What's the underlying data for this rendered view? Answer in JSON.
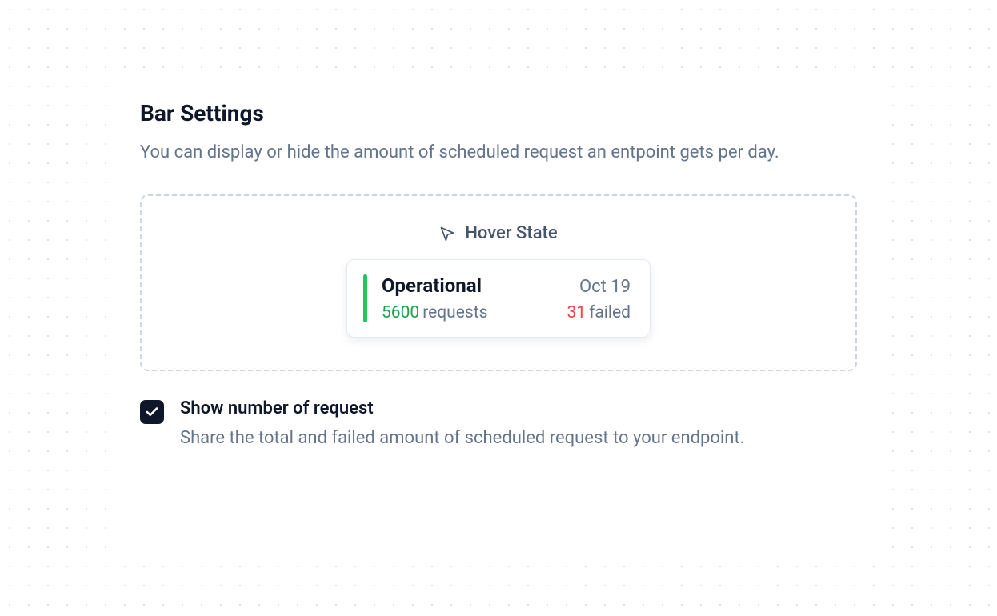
{
  "header": {
    "title": "Bar Settings",
    "description": "You can display or hide the amount of scheduled request an entpoint gets per day."
  },
  "preview": {
    "hoverLabel": "Hover State",
    "card": {
      "status": "Operational",
      "date": "Oct 19",
      "requestsCount": "5600",
      "requestsLabel": "requests",
      "failedCount": "31",
      "failedLabel": "failed"
    }
  },
  "option": {
    "title": "Show number of request",
    "description": "Share the total and failed amount of scheduled request to your endpoint.",
    "checked": true
  },
  "colors": {
    "textPrimary": "#0f172a",
    "textSecondary": "#64748b",
    "success": "#16a34a",
    "danger": "#ef4444",
    "indicator": "#22c55e"
  }
}
